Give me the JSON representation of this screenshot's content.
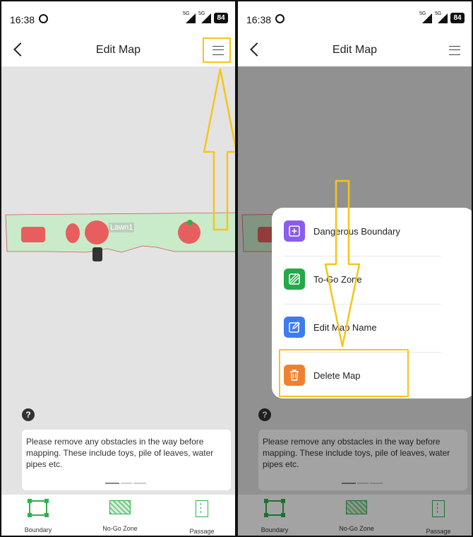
{
  "status_bar": {
    "time": "16:38",
    "signal_1": "5G",
    "signal_2": "5G",
    "battery": "84"
  },
  "header": {
    "title": "Edit Map",
    "back_icon": "chevron-left-icon",
    "menu_icon": "hamburger-menu-icon"
  },
  "map": {
    "area_label": "Lawn1",
    "lawn_color": "#c9ebc9",
    "obstacle_color": "#e85e5e"
  },
  "help": {
    "label": "?"
  },
  "info_card": {
    "text": "Please remove any obstacles in the way before mapping. These include toys, pile of leaves, water pipes etc."
  },
  "toolbar": {
    "items": [
      {
        "label": "Boundary",
        "icon": "boundary-icon"
      },
      {
        "label": "No-Go Zone",
        "icon": "no-go-zone-icon"
      },
      {
        "label": "Passage",
        "icon": "passage-icon"
      }
    ]
  },
  "menu": {
    "items": [
      {
        "label": "Dangerous Boundary",
        "icon": "plus-square-icon",
        "color": "#8a5cf0"
      },
      {
        "label": "To-Go Zone",
        "icon": "hatched-square-icon",
        "color": "#22a94a"
      },
      {
        "label": "Edit Map Name",
        "icon": "edit-icon",
        "color": "#3d7bf0"
      },
      {
        "label": "Delete Map",
        "icon": "trash-icon",
        "color": "#f08030"
      }
    ]
  },
  "annotation_color": "#f5c518",
  "accent_green": "#2fb14a"
}
